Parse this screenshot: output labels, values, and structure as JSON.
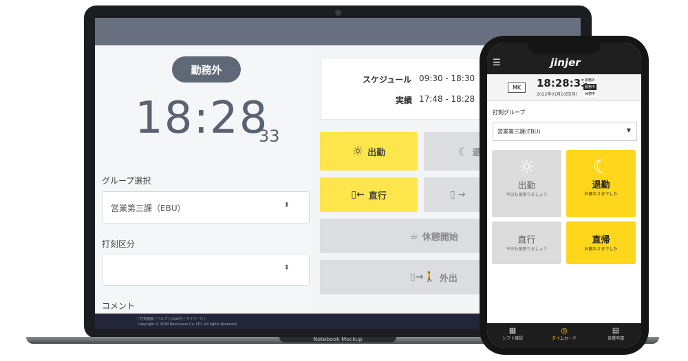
{
  "laptop": {
    "status_badge": "勤務外",
    "clock": {
      "hm": "18:28",
      "sec": "33"
    },
    "group_label": "グループ選択",
    "group_value": "営業第三課（EBU）",
    "punch_label": "打刻区分",
    "punch_value": "",
    "comment_label": "コメント",
    "schedule": {
      "schedule_label": "スケジュール",
      "schedule_value": "09:30 - 18:30",
      "actual_label": "実績",
      "actual_value": "17:48 - 18:28"
    },
    "buttons": {
      "clock_in": "出勤",
      "clock_out": "退",
      "direct_go": "直行",
      "direct_return": "→",
      "break_start": "休憩開始",
      "go_out": "外出"
    },
    "footer_links": "| 打刻画面 | ヘルプ | jinjer社 | マイページ |",
    "footer_copyright": "Copyright © 2018 NeoCareer Co.,LTD. All rights Reserved",
    "mockup_label": "Notebook Mockup"
  },
  "phone": {
    "logo": "jinjer",
    "initials": "MK",
    "time": "18:28:33",
    "date": "2022年01月10日(月)",
    "state_tags": [
      "勤務外",
      "勤務中",
      "休憩中"
    ],
    "group_label": "打刻グループ",
    "group_value": "営業第三課(EBU)",
    "tiles": [
      {
        "title": "出勤",
        "sub": "今日も頑張りましょう"
      },
      {
        "title": "退勤",
        "sub": "お疲れさまでした"
      },
      {
        "title": "直行",
        "sub": "今日も頑張りましょう"
      },
      {
        "title": "直帰",
        "sub": "お疲れさまでした"
      }
    ],
    "nav": [
      "シフト確認",
      "タイムカード",
      "各種申請"
    ]
  },
  "colors": {
    "yellow": "#fde64b",
    "phone_yellow": "#fed61c",
    "slate": "#5f6877"
  }
}
